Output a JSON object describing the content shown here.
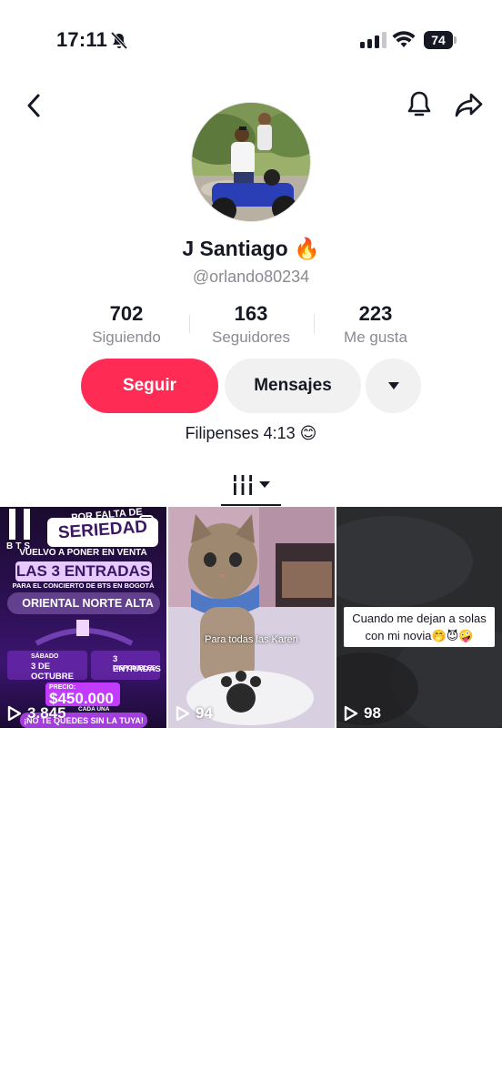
{
  "status_bar": {
    "time": "17:11",
    "battery": "74"
  },
  "profile": {
    "display_name": "J Santiago",
    "name_emoji": "🔥",
    "username": "@orlando80234",
    "bio_text": "Filipenses 4:13",
    "bio_emoji": "😊"
  },
  "stats": [
    {
      "value": "702",
      "label": "Siguiendo"
    },
    {
      "value": "163",
      "label": "Seguidores"
    },
    {
      "value": "223",
      "label": "Me gusta"
    }
  ],
  "actions": {
    "follow_label": "Seguir",
    "message_label": "Mensajes"
  },
  "videos": [
    {
      "views": "3.845",
      "lines": {
        "band": "BTS",
        "l1": "POR FALTA DE",
        "l2": "SERIEDAD",
        "l3": "VUELVO A PONER EN VENTA",
        "l4": "LAS 3 ENTRADAS",
        "l5": "PARA EL CONCIERTO DE BTS EN BOGOTÁ",
        "l6": "ORIENTAL NORTE ALTA",
        "l7": "SÁBADO",
        "l8": "3 DE OCTUBRE",
        "l9": "3 ENTRADAS",
        "l10": "DISPONIBLES",
        "l11": "PRECIO:",
        "l12": "$450.000",
        "l13": "CADA UNA",
        "l14": "¡NO TE QUEDES SIN LA TUYA!"
      }
    },
    {
      "views": "94",
      "caption": "Para todas las Karen"
    },
    {
      "views": "98",
      "caption": "Cuando me dejan a solas con mi novia",
      "caption_emoji": "🤭😈🤪"
    }
  ],
  "colors": {
    "accent": "#fe2c55",
    "secondary_button": "#f1f1f2",
    "muted_text": "#8a8b91"
  }
}
